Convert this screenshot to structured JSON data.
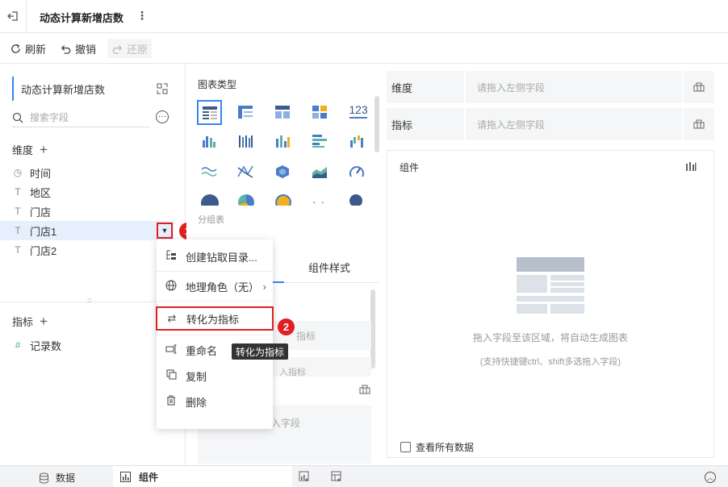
{
  "header": {
    "title": "动态计算新增店数"
  },
  "toolbar": {
    "refresh": "刷新",
    "undo": "撤销",
    "redo": "还原"
  },
  "left": {
    "dataset": "动态计算新增店数",
    "search_placeholder": "搜索字段",
    "dimension_title": "维度",
    "dimensions": [
      {
        "icon": "clock-icon",
        "label": "时间"
      },
      {
        "icon": "text-icon",
        "label": "地区"
      },
      {
        "icon": "text-icon",
        "label": "门店"
      },
      {
        "icon": "text-icon",
        "label": "门店1"
      },
      {
        "icon": "text-icon",
        "label": "门店2"
      }
    ],
    "measure_title": "指标",
    "measures": [
      {
        "icon": "hash-icon",
        "label": "记录数"
      }
    ]
  },
  "context_menu": {
    "items": [
      "创建钻取目录...",
      "地理角色（无）",
      "转化为指标",
      "重命名",
      "复制",
      "删除"
    ],
    "tooltip": "转化为指标",
    "badge1": "1",
    "badge2": "2"
  },
  "middle": {
    "chart_type_title": "图表类型",
    "table_label": "123",
    "group_table": "分组表",
    "tab_style": "组件样式",
    "peek_text_1": "指标",
    "peek_text_2": "入指标",
    "peek_text_3": "入字段"
  },
  "right": {
    "dimension_label": "维度",
    "measure_label": "指标",
    "drop_placeholder": "请拖入左侧字段",
    "component_title": "组件",
    "empty_hint1": "拖入字段至该区域，将自动生成图表",
    "empty_hint2": "(支持快捷键ctrl、shift多选拖入字段)",
    "view_all": "查看所有数据"
  },
  "bottom": {
    "data_tab": "数据",
    "component_tab": "组件"
  },
  "colors": {
    "accent": "#3685f2",
    "red": "#e02020",
    "selected": "#e6effc"
  }
}
